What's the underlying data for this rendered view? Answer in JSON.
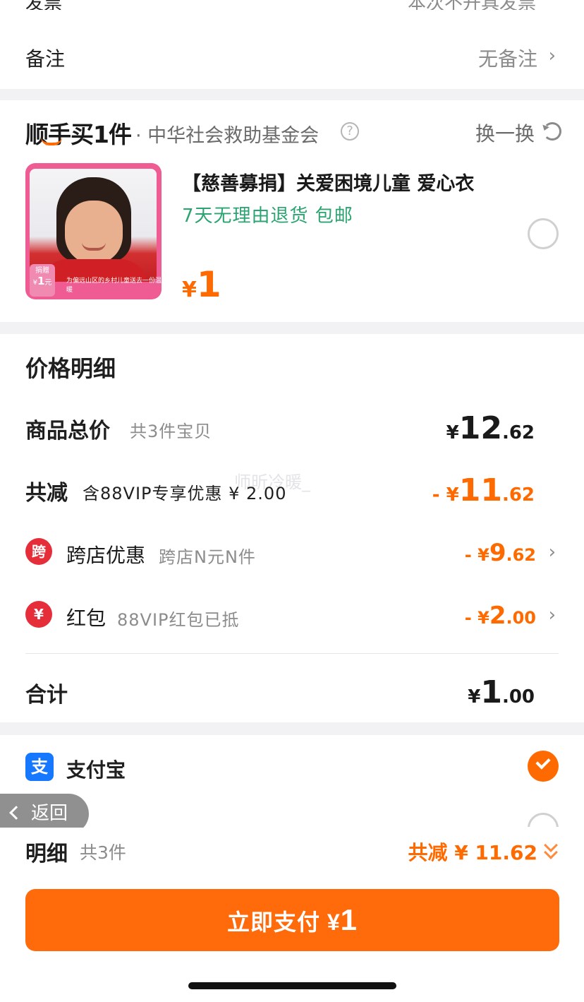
{
  "top_partial": {
    "label": "发票",
    "value": "本次不开具发票"
  },
  "remark": {
    "label": "备注",
    "value": "无备注"
  },
  "charity": {
    "brand": "顺手买1件",
    "org": "· 中华社会救助基金会",
    "swap_label": "换一换",
    "product": {
      "title": "【慈善募捐】关爱困境儿童 爱心衣",
      "tags": "7天无理由退货  包邮",
      "price_currency": "¥",
      "price_value": "1",
      "thumb_badge_top": "捐赠",
      "thumb_badge_value": "1",
      "thumb_badge_unit": "元",
      "thumb_caption": "为偏远山区的乡村儿童送去一份温暖"
    }
  },
  "price_detail": {
    "title": "价格明细",
    "subtotal": {
      "label": "商品总价",
      "sub": "共3件宝贝",
      "currency": "¥",
      "int": "12",
      "dec": ".62"
    },
    "total_discount": {
      "label": "共减",
      "sub": "含88VIP专享优惠 ¥ 2.00",
      "prefix": "- ¥",
      "int": "11",
      "dec": ".62"
    },
    "items": [
      {
        "icon_text": "跨",
        "label": "跨店优惠",
        "sub": "跨店N元N件",
        "prefix": "- ¥",
        "int": "9",
        "dec": ".62"
      },
      {
        "icon_text": "¥",
        "label": "红包",
        "sub": "88VIP红包已抵",
        "prefix": "- ¥",
        "int": "2",
        "dec": ".00"
      }
    ],
    "total": {
      "label": "合计",
      "currency": "¥",
      "int": "1",
      "dec": ".00"
    },
    "watermark": "师昕冷暖_"
  },
  "payment": {
    "method_icon": "支",
    "method_label": "支付宝"
  },
  "back_button": {
    "label": "返回"
  },
  "footer": {
    "title": "明细",
    "count": "共3件",
    "discount": "共减 ¥ 11.62",
    "pay_label": "立即支付 ¥",
    "pay_amount": "1"
  },
  "colors": {
    "accent": "#ff6a00",
    "green": "#2ba471",
    "alipay": "#1677ff",
    "red_icon": "#e62e3b"
  }
}
